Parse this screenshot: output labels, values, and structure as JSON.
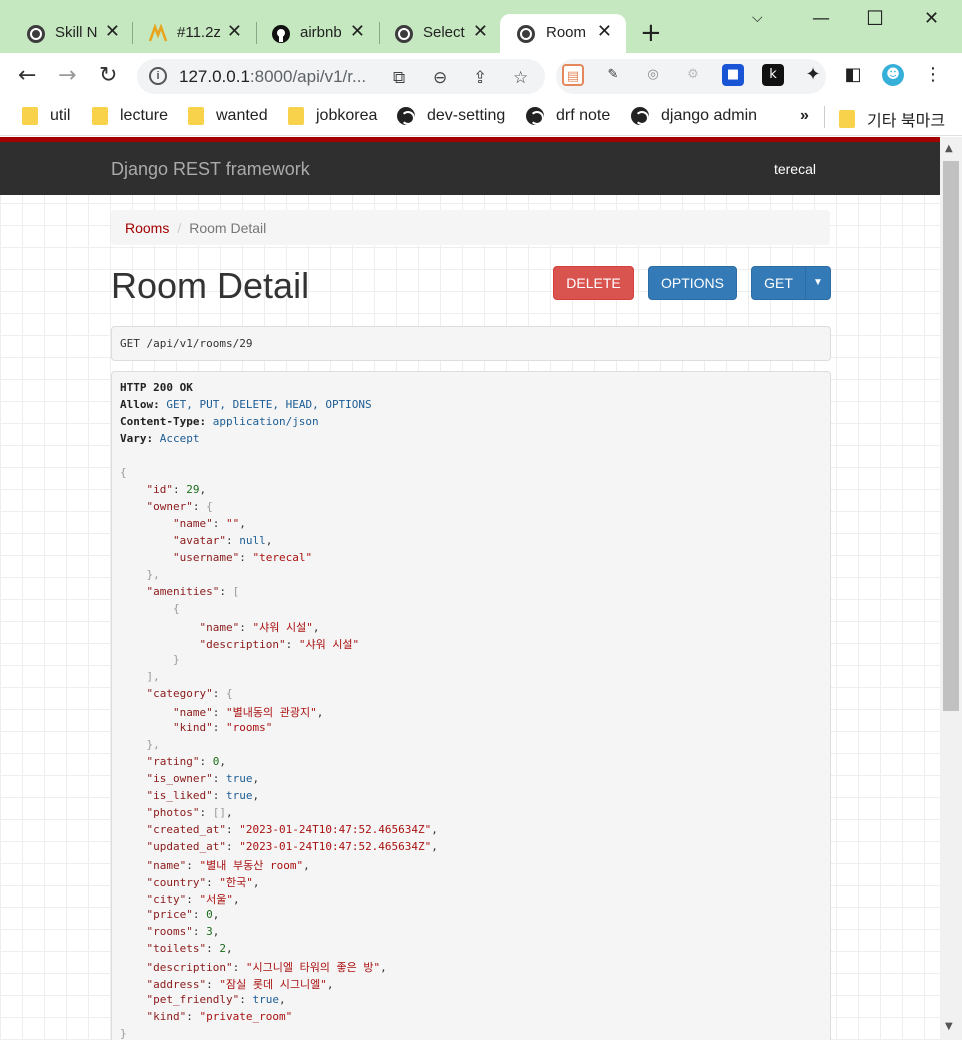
{
  "browser": {
    "tabs": [
      {
        "title": "Skill N",
        "icon": "globe-icon"
      },
      {
        "title": "#11.2z",
        "icon": "m-logo-icon"
      },
      {
        "title": "airbnb",
        "icon": "github-icon"
      },
      {
        "title": "Select",
        "icon": "globe-icon"
      },
      {
        "title": "Room",
        "icon": "globe-icon",
        "active": true
      }
    ],
    "url_host": "127.0.0.1",
    "url_rest": ":8000/api/v1/r...",
    "bookmarks": [
      {
        "label": "util",
        "type": "folder"
      },
      {
        "label": "lecture",
        "type": "folder"
      },
      {
        "label": "wanted",
        "type": "folder"
      },
      {
        "label": "jobkorea",
        "type": "folder"
      },
      {
        "label": "dev-setting",
        "type": "site"
      },
      {
        "label": "drf note",
        "type": "site"
      },
      {
        "label": "django admin",
        "type": "site"
      },
      {
        "label": "기타 북마크",
        "type": "folder"
      }
    ],
    "bookmarks_more": "»"
  },
  "page": {
    "brand": "Django REST framework",
    "user": "terecal",
    "breadcrumb": {
      "root": "Rooms",
      "current": "Room Detail"
    },
    "title": "Room Detail",
    "buttons": {
      "delete": "DELETE",
      "options": "OPTIONS",
      "get": "GET"
    },
    "request_line": "GET /api/v1/rooms/29"
  },
  "response": {
    "status": "HTTP 200 OK",
    "headers": [
      {
        "name": "Allow:",
        "value": "GET, PUT, DELETE, HEAD, OPTIONS"
      },
      {
        "name": "Content-Type:",
        "value": "application/json"
      },
      {
        "name": "Vary:",
        "value": "Accept"
      }
    ],
    "body": {
      "id": "29",
      "owner_name": "\"\"",
      "owner_avatar": "null",
      "owner_username": "\"terecal\"",
      "amenity_name": "\"샤워 시설\"",
      "amenity_description": "\"샤워 시설\"",
      "category_name": "\"별내동의 관광지\"",
      "category_kind": "\"rooms\"",
      "rating": "0",
      "is_owner": "true",
      "is_liked": "true",
      "photos": "[]",
      "created_at": "\"2023-01-24T10:47:52.465634Z\"",
      "updated_at": "\"2023-01-24T10:47:52.465634Z\"",
      "name": "\"별내 부동산 room\"",
      "country": "\"한국\"",
      "city": "\"서울\"",
      "price": "0",
      "rooms": "3",
      "toilets": "2",
      "description": "\"시그니엘 타워의 좋은 방\"",
      "address": "\"잠실 롯데 시그니엘\"",
      "pet_friendly": "true",
      "kind": "\"private_room\""
    }
  }
}
